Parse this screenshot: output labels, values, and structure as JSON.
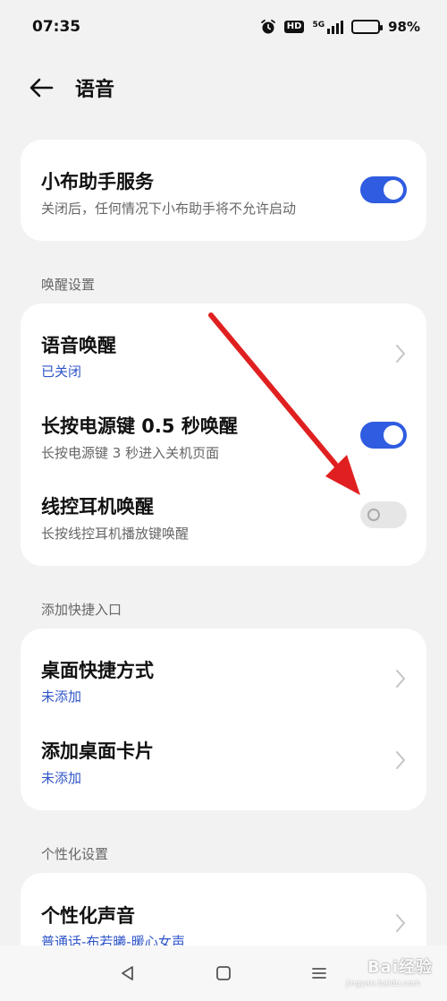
{
  "status_bar": {
    "time": "07:35",
    "hd": "HD",
    "signal": "5G",
    "battery": "98%"
  },
  "header": {
    "title": "语音"
  },
  "assistant_card": {
    "title": "小布助手服务",
    "subtitle": "关闭后，任何情况下小布助手将不允许启动",
    "toggle_on": true
  },
  "wake_section": {
    "label": "唤醒设置",
    "items": [
      {
        "title": "语音唤醒",
        "subtitle": "已关闭",
        "control": "chevron"
      },
      {
        "title": "长按电源键 0.5 秒唤醒",
        "subtitle": "长按电源键 3 秒进入关机页面",
        "control": "toggle",
        "toggle_on": true
      },
      {
        "title": "线控耳机唤醒",
        "subtitle": "长按线控耳机播放键唤醒",
        "control": "toggle",
        "toggle_on": false
      }
    ]
  },
  "shortcut_section": {
    "label": "添加快捷入口",
    "items": [
      {
        "title": "桌面快捷方式",
        "subtitle": "未添加",
        "control": "chevron"
      },
      {
        "title": "添加桌面卡片",
        "subtitle": "未添加",
        "control": "chevron"
      }
    ]
  },
  "personal_section": {
    "label": "个性化设置",
    "items": [
      {
        "title": "个性化声音",
        "subtitle": "普通话-布若曦-暖心女声",
        "control": "chevron"
      }
    ]
  },
  "nav_bar": {
    "icons": [
      "back-triangle-icon",
      "home-square-icon",
      "recents-menu-icon"
    ]
  },
  "watermark": {
    "text": "Bai经验",
    "sub": "jingyan.baidu.com"
  },
  "colors": {
    "accent": "#2f5ce0",
    "link": "#2f55c8",
    "arrow": "#e02020"
  }
}
